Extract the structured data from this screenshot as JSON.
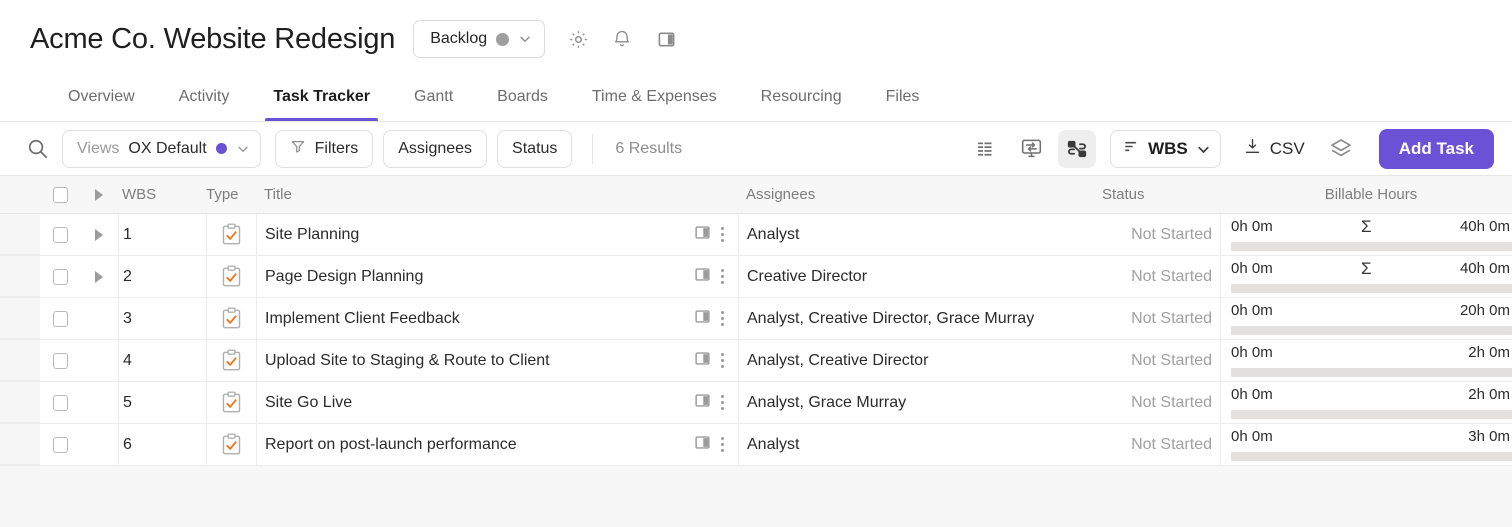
{
  "header": {
    "project_title": "Acme Co. Website Redesign",
    "status_label": "Backlog",
    "status_dot_color": "#9e9e9e",
    "icons": [
      "gear-icon",
      "bell-icon",
      "panel-toggle-icon"
    ]
  },
  "tabs": [
    {
      "label": "Overview",
      "active": false
    },
    {
      "label": "Activity",
      "active": false
    },
    {
      "label": "Task Tracker",
      "active": true
    },
    {
      "label": "Gantt",
      "active": false
    },
    {
      "label": "Boards",
      "active": false
    },
    {
      "label": "Time & Expenses",
      "active": false
    },
    {
      "label": "Resourcing",
      "active": false
    },
    {
      "label": "Files",
      "active": false
    }
  ],
  "toolbar": {
    "views_label": "Views",
    "views_value": "OX Default",
    "views_dot_color": "#6a51d6",
    "filters_label": "Filters",
    "assignees_label": "Assignees",
    "status_label": "Status",
    "results_label": "6 Results",
    "sort_label": "WBS",
    "csv_label": "CSV",
    "add_task_label": "Add Task",
    "accent_color": "#6a51d6"
  },
  "table": {
    "columns": [
      "WBS",
      "Type",
      "Title",
      "Assignees",
      "Status",
      "Billable Hours"
    ],
    "rows": [
      {
        "wbs": "1",
        "expandable": true,
        "title": "Site Planning",
        "assignees": "Analyst",
        "status": "Not Started",
        "hours_logged": "0h 0m",
        "hours_total": "40h 0m",
        "rollup": "Σ"
      },
      {
        "wbs": "2",
        "expandable": true,
        "title": "Page Design Planning",
        "assignees": "Creative Director",
        "status": "Not Started",
        "hours_logged": "0h 0m",
        "hours_total": "40h 0m",
        "rollup": "Σ"
      },
      {
        "wbs": "3",
        "expandable": false,
        "title": "Implement Client Feedback",
        "assignees": "Analyst, Creative Director, Grace Murray",
        "status": "Not Started",
        "hours_logged": "0h 0m",
        "hours_total": "20h 0m",
        "rollup": ""
      },
      {
        "wbs": "4",
        "expandable": false,
        "title": "Upload Site to Staging & Route to Client",
        "assignees": "Analyst, Creative Director",
        "status": "Not Started",
        "hours_logged": "0h 0m",
        "hours_total": "2h 0m",
        "rollup": ""
      },
      {
        "wbs": "5",
        "expandable": false,
        "title": "Site Go Live",
        "assignees": "Analyst, Grace Murray",
        "status": "Not Started",
        "hours_logged": "0h 0m",
        "hours_total": "2h 0m",
        "rollup": ""
      },
      {
        "wbs": "6",
        "expandable": false,
        "title": "Report on post-launch performance",
        "assignees": "Analyst",
        "status": "Not Started",
        "hours_logged": "0h 0m",
        "hours_total": "3h 0m",
        "rollup": ""
      }
    ]
  }
}
